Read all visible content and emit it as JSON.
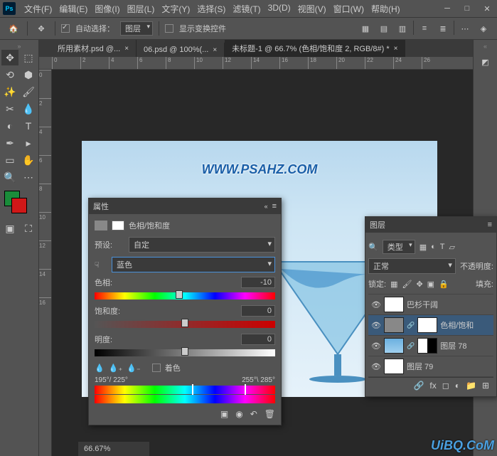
{
  "menu": [
    "文件(F)",
    "编辑(E)",
    "图像(I)",
    "图层(L)",
    "文字(Y)",
    "选择(S)",
    "滤镜(T)",
    "3D(D)",
    "视图(V)",
    "窗口(W)",
    "帮助(H)"
  ],
  "optbar": {
    "auto_select": "自动选择：",
    "layer": "图层",
    "show_transform": "显示变换控件"
  },
  "tabs": [
    {
      "label": "所用素材.psd @...",
      "active": false
    },
    {
      "label": "06.psd @ 100%(...",
      "active": false
    },
    {
      "label": "未标题-1 @ 66.7% (色相/饱和度 2, RGB/8#) *",
      "active": true
    }
  ],
  "ruler_h": [
    "0",
    "2",
    "4",
    "6",
    "8",
    "10",
    "12",
    "14",
    "16",
    "18",
    "20",
    "22",
    "24",
    "26"
  ],
  "ruler_v": [
    "0",
    "2",
    "4",
    "6",
    "8",
    "10",
    "12",
    "14",
    "16"
  ],
  "watermark": "WWW.PSAHZ.COM",
  "properties": {
    "title": "属性",
    "adj_name": "色相/饱和度",
    "preset_label": "预设:",
    "preset_value": "自定",
    "channel_value": "蓝色",
    "hue_label": "色相:",
    "hue_value": "-10",
    "sat_label": "饱和度:",
    "sat_value": "0",
    "light_label": "明度:",
    "light_value": "0",
    "colorize": "着色",
    "range_left": "195°/ 225°",
    "range_right": "255°\\ 285°"
  },
  "layers": {
    "title": "图层",
    "kind": "类型",
    "blend": "正常",
    "opacity_label": "不透明度:",
    "lock_label": "锁定:",
    "fill_label": "填充:",
    "items": [
      {
        "name": "巴杉干阔"
      },
      {
        "name": "色相/饱和"
      },
      {
        "name": "图层 78"
      },
      {
        "name": "图层 79"
      }
    ]
  },
  "zoom": "66.67%",
  "brand": "UiBQ.CoM",
  "colors": {
    "fg": "#1a8c3a",
    "bg": "#d01818"
  }
}
